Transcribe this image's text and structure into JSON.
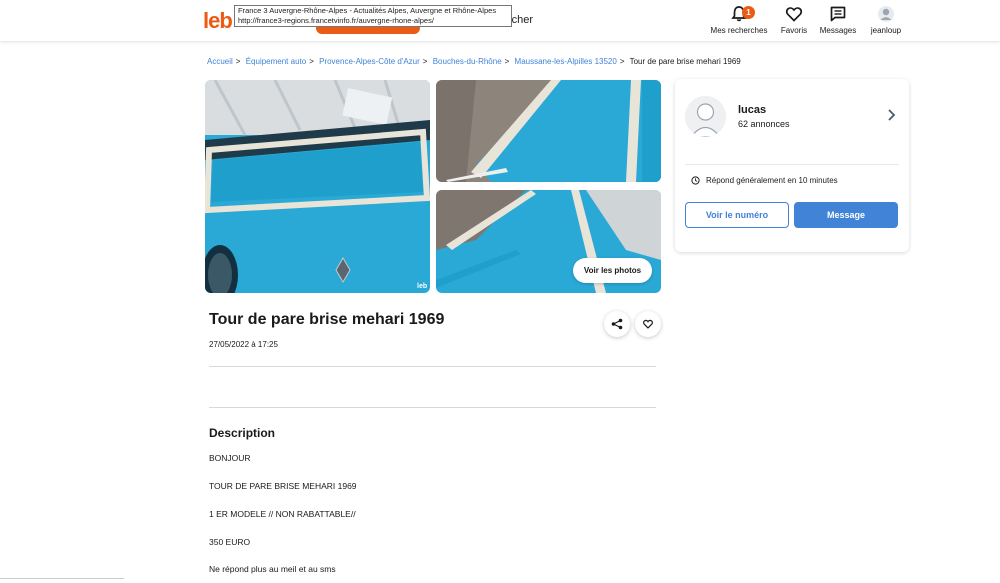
{
  "header": {
    "logo": "leb",
    "search_partial": "rcher",
    "tooltip_line1": "France 3 Auvergne-Rhône-Alpes - Actualités Alpes, Auvergne et Rhône-Alpes",
    "tooltip_line2": "http://france3-regions.francetvinfo.fr/auvergne-rhone-alpes/",
    "nav": [
      {
        "label": "Mes recherches",
        "icon": "bell-icon",
        "badge": "1"
      },
      {
        "label": "Favoris",
        "icon": "heart-icon"
      },
      {
        "label": "Messages",
        "icon": "message-icon"
      },
      {
        "label": "jeanloup",
        "icon": "user-avatar-icon"
      }
    ]
  },
  "breadcrumb": [
    "Accueil",
    "Équipement auto",
    "Provence-Alpes-Côte d'Azur",
    "Bouches-du-Rhône",
    "Maussane-les-Alpilles 13520",
    "Tour de pare brise mehari 1969"
  ],
  "gallery": {
    "see_photos": "Voir les photos",
    "watermark": "leb"
  },
  "ad": {
    "title": "Tour de pare brise mehari 1969",
    "date": "27/05/2022 à 17:25",
    "description_title": "Description",
    "description_lines": [
      "BONJOUR",
      "TOUR DE PARE BRISE MEHARI 1969",
      "1 ER MODELE // NON RABATTABLE//",
      "350 EURO",
      "Ne répond plus au meil et au sms"
    ]
  },
  "seller": {
    "name": "lucas",
    "ads_count": "62 annonces",
    "response_time": "Répond généralement en 10 minutes",
    "btn_number": "Voir le numéro",
    "btn_message": "Message"
  },
  "colors": {
    "brand": "#ec5a13",
    "link": "#4183d7",
    "car_blue": "#2aa9d6"
  }
}
